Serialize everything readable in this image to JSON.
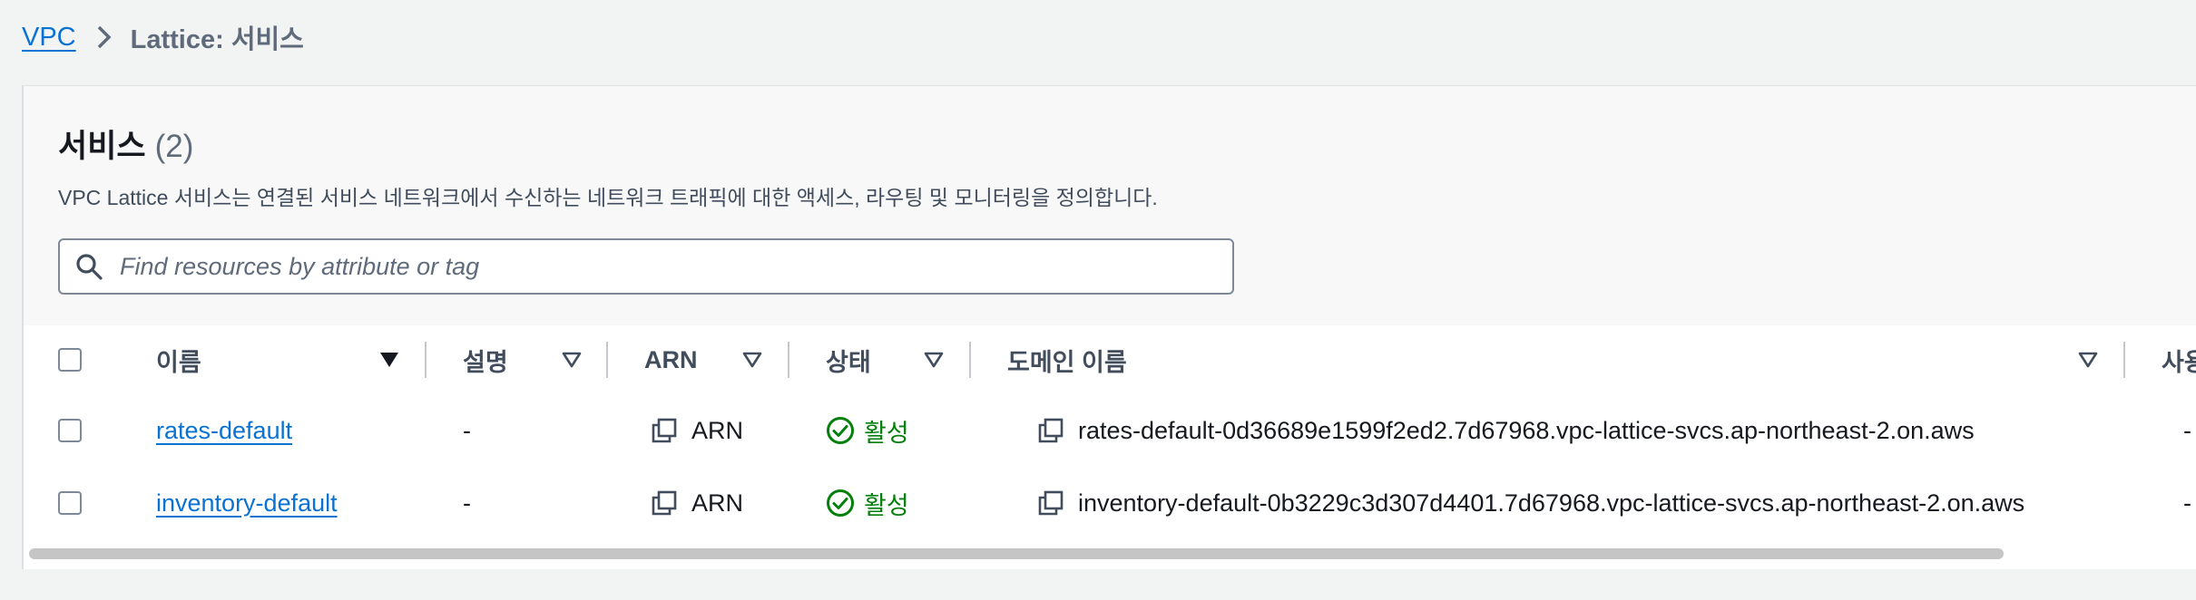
{
  "breadcrumb": {
    "root": "VPC",
    "current": "Lattice: 서비스"
  },
  "panel": {
    "title": "서비스",
    "count": "(2)",
    "description": "VPC Lattice 서비스는 연결된 서비스 네트워크에서 수신하는 네트워크 트래픽에 대한 액세스, 라우팅 및 모니터링을 정의합니다.",
    "search_placeholder": "Find resources by attribute or tag"
  },
  "table": {
    "columns": {
      "name": "이름",
      "description": "설명",
      "arn": "ARN",
      "status": "상태",
      "domain": "도메인 이름",
      "extra": "사용"
    },
    "rows": [
      {
        "name": "rates-default",
        "description": "-",
        "arn": "ARN",
        "status": "활성",
        "domain": "rates-default-0d36689e1599f2ed2.7d67968.vpc-lattice-svcs.ap-northeast-2.on.aws",
        "extra": "-"
      },
      {
        "name": "inventory-default",
        "description": "-",
        "arn": "ARN",
        "status": "활성",
        "domain": "inventory-default-0b3229c3d307d4401.7d67968.vpc-lattice-svcs.ap-northeast-2.on.aws",
        "extra": "-"
      }
    ]
  },
  "colors": {
    "link": "#0972d3",
    "success": "#037f0c",
    "border": "#7d8998"
  },
  "icons": {
    "separator": "chevron-right-icon",
    "search": "search-icon",
    "copy": "copy-icon",
    "status": "check-circle-icon",
    "sort_active": "caret-down-filled-icon",
    "sort": "caret-down-outline-icon"
  }
}
